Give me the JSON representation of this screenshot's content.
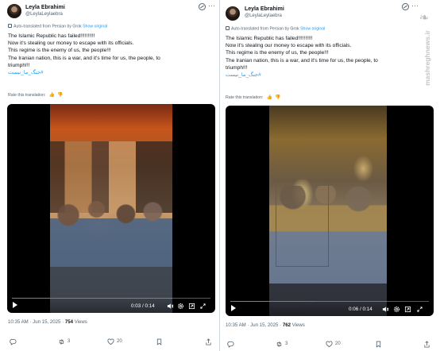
{
  "colors": {
    "accent": "#1d9bf0",
    "muted": "#536471",
    "text": "#0f1419",
    "highlight_box": "#e0261c"
  },
  "tweets": [
    {
      "user": {
        "name": "Leyla Ebrahimi",
        "handle": "@LeylaLeylaebra"
      },
      "translation": {
        "note": "Auto-translated from Persian by Grok",
        "show_original": "Show original"
      },
      "lines": [
        "The Islamic Republic has failed!!!!!!!!!!",
        "Now it's stealing our money to escape with its officials.",
        "This regime is the enemy of us, the people!!!",
        "The Iranian nation, this is a war, and it's time for us, the people, to",
        "triumph!!!"
      ],
      "hashtag": "#جنگ_ما_نیست",
      "rate_label": "Rate this translation:",
      "video": {
        "time": "0:03 / 0:14",
        "progress": 0.21
      },
      "meta": {
        "time": "10:35 AM · Jun 15, 2025 · ",
        "views": "754",
        "views_label": " Views"
      },
      "actions": {
        "retweets": "3",
        "likes": "20"
      }
    },
    {
      "user": {
        "name": "Leyla Ebrahimi",
        "handle": "@LeylaLeylaebra"
      },
      "translation": {
        "note": "Auto-translated from Persian by Grok",
        "show_original": "Show original"
      },
      "lines": [
        "The Islamic Republic has failed!!!!!!!!!!",
        "Now it's stealing our money to escape with its officials.",
        "This regime is the enemy of us, the people!!!",
        "The Iranian nation, this is a war, and it's time for us, the people, to",
        "triumph!!!"
      ],
      "hashtag": "#جنگ_ما_نیست",
      "rate_label": "Rate this translation:",
      "video": {
        "time": "0:06 / 0:14",
        "progress": 0.43
      },
      "meta": {
        "time": "10:35 AM · Jun 15, 2025 · ",
        "views": "762",
        "views_label": " Views"
      },
      "actions": {
        "retweets": "3",
        "likes": "20"
      }
    }
  ],
  "watermark": {
    "text": "mashreghnews.ir"
  }
}
